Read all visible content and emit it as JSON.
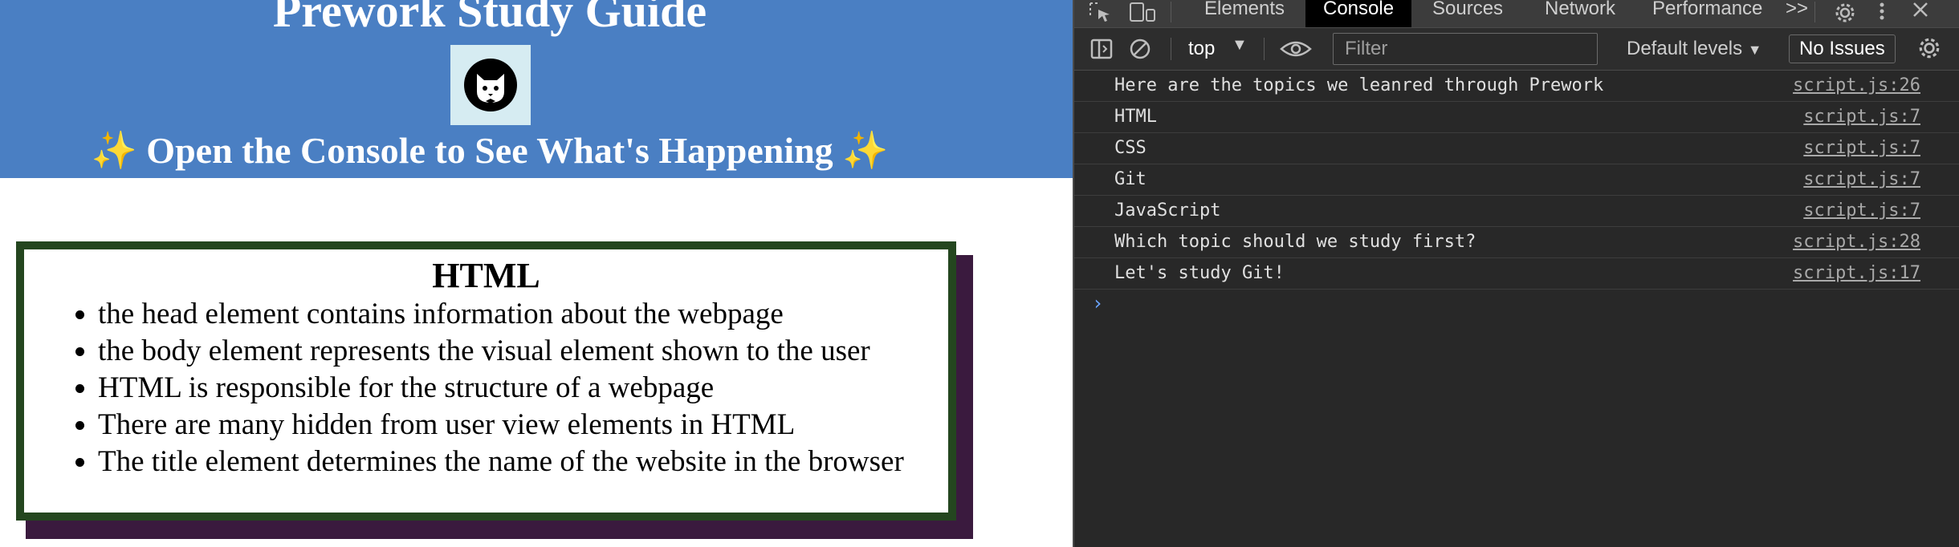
{
  "page": {
    "title": "Prework Study Guide",
    "subtitle_left_emoji": "✨",
    "subtitle": "Open the Console to See What's Happening",
    "subtitle_right_emoji": "✨",
    "card": {
      "heading": "HTML",
      "items": [
        "the head element contains information about the webpage",
        "the body element represents the visual element shown to the user",
        "HTML is responsible for the structure of a webpage",
        "There are many hidden from user view elements in HTML",
        "The title element determines the name of the website in the browser"
      ]
    },
    "colors": {
      "hero": "#4a7fc3",
      "card_border": "#24461f",
      "card_shadow": "#3a1a3e"
    }
  },
  "devtools": {
    "tabs": [
      "Elements",
      "Console",
      "Sources",
      "Network",
      "Performance"
    ],
    "active_tab": "Console",
    "more": ">>",
    "toolbar": {
      "context": "top",
      "filter_placeholder": "Filter",
      "levels": "Default levels",
      "issues": "No Issues"
    },
    "console": [
      {
        "message": "Here are the topics we leanred through Prework",
        "source": "script.js:26"
      },
      {
        "message": "HTML",
        "source": "script.js:7"
      },
      {
        "message": "CSS",
        "source": "script.js:7"
      },
      {
        "message": "Git",
        "source": "script.js:7"
      },
      {
        "message": "JavaScript",
        "source": "script.js:7"
      },
      {
        "message": "Which topic should we study first?",
        "source": "script.js:28"
      },
      {
        "message": "Let's study Git!",
        "source": "script.js:17"
      }
    ],
    "prompt": "›"
  }
}
